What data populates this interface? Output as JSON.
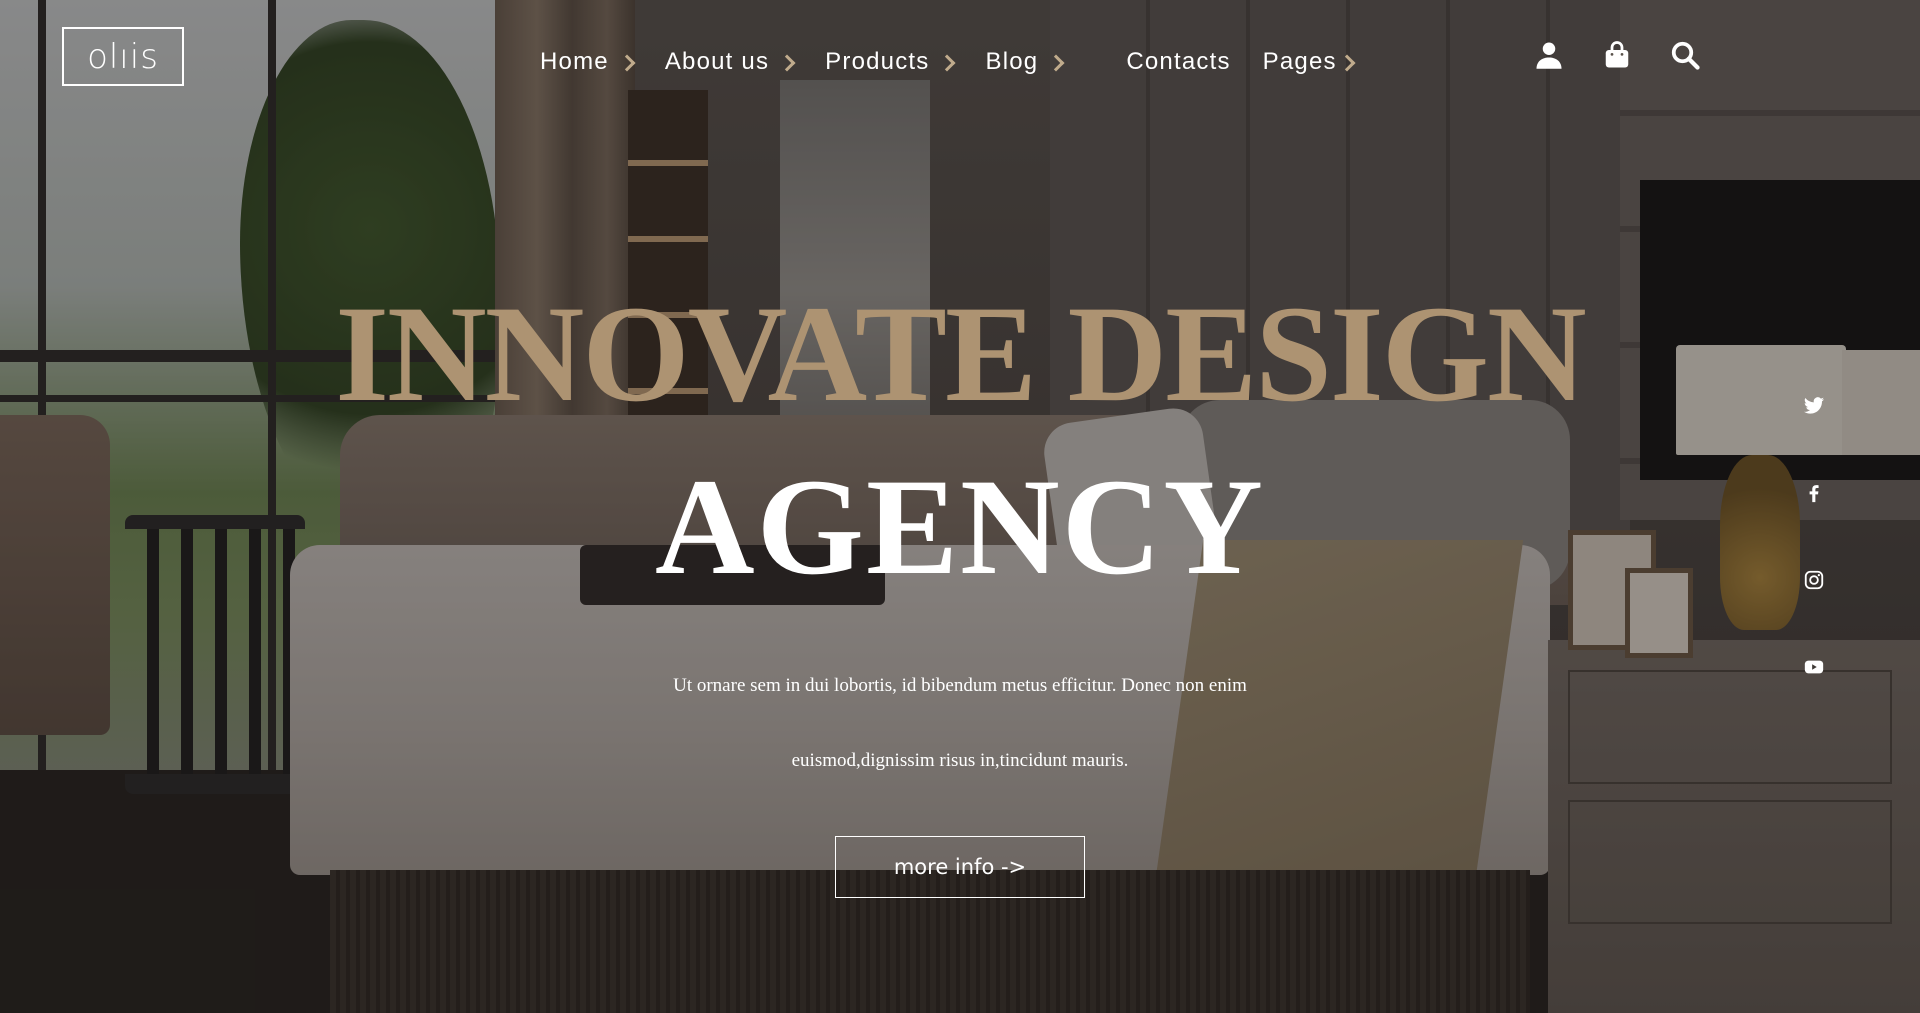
{
  "brand": {
    "logo_text": "olıis"
  },
  "nav": {
    "items": [
      {
        "label": "Home"
      },
      {
        "label": "About us"
      },
      {
        "label": "Products"
      },
      {
        "label": "Blog"
      },
      {
        "label": "Contacts"
      },
      {
        "label": "Pages"
      }
    ]
  },
  "header_icons": [
    "user-icon",
    "shopping-bag-icon",
    "search-icon"
  ],
  "hero": {
    "title_line_1": "INNOVATE DESIGN",
    "title_line_2": "AGENCY",
    "subtitle_line_1": "Ut ornare sem in dui lobortis, id bibendum metus efficitur. Donec non enim",
    "subtitle_line_2": "euismod,dignissim risus in,tincidunt mauris.",
    "cta_label": "more info ->"
  },
  "social": [
    "twitter-icon",
    "facebook-icon",
    "instagram-icon",
    "youtube-icon"
  ],
  "colors": {
    "accent_gold": "#ad9372",
    "chevron": "#c0ab8c",
    "text": "#ffffff"
  }
}
